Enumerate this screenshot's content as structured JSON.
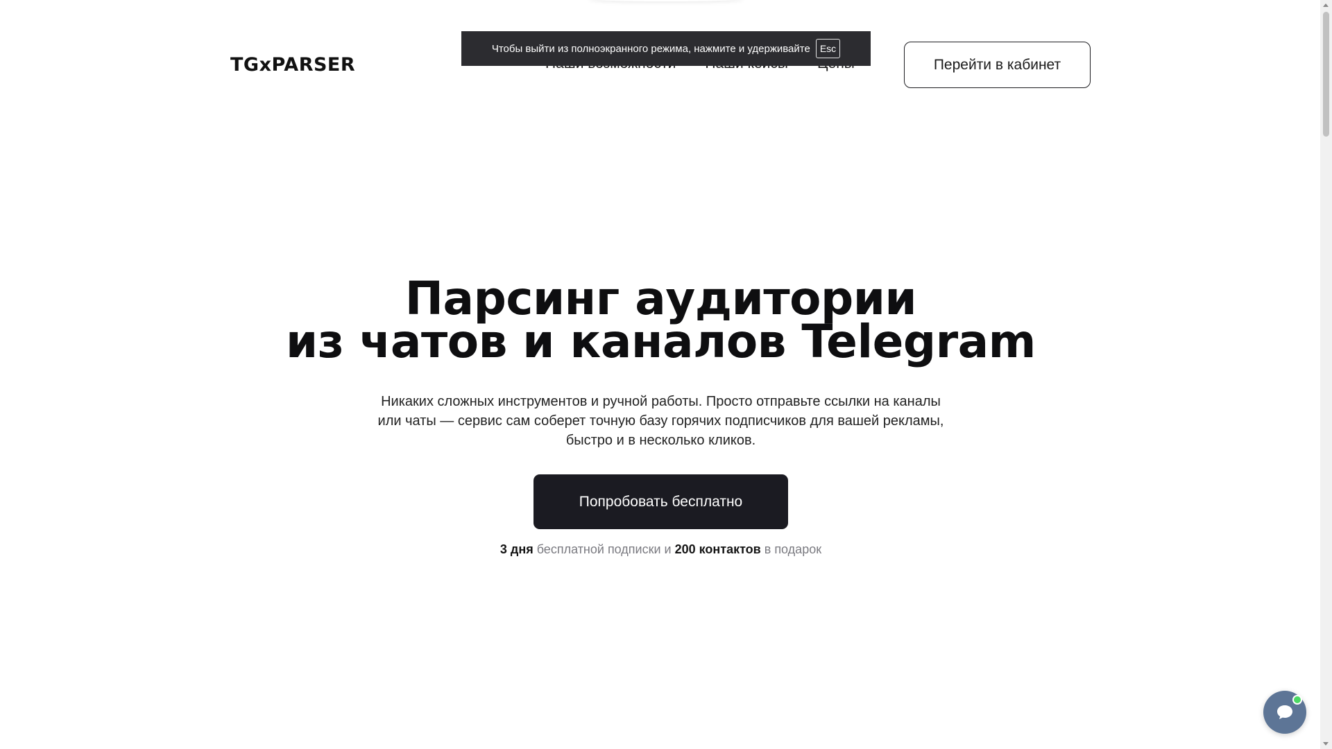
{
  "header": {
    "logo": "TGxPARSER",
    "nav": [
      "Наши возможности",
      "Наши кейсы",
      "Цены"
    ],
    "cabinet_button": "Перейти в кабинет"
  },
  "fullscreen_notice": {
    "text": "Чтобы выйти из полноэкранного режима, нажмите и удерживайте",
    "key": "Esc"
  },
  "hero": {
    "title_line1": "Парсинг аудитории",
    "title_line2": "из чатов и каналов Telegram",
    "subtitle": "Никаких сложных инструментов и ручной работы. Просто отправьте ссылки на каналы или чаты — сервис сам соберет точную базу горячих подписчиков для вашей рекламы, быстро и в несколько кликов.",
    "cta_button": "Попробовать бесплатно",
    "gift_note": {
      "part1_bold": "3 дня",
      "part2": " бесплатной подписки и ",
      "part3_bold": "200 контактов",
      "part4": " в подарок"
    }
  },
  "chat_widget": {
    "icon": "chat-bubble-icon",
    "status": "online"
  },
  "colors": {
    "primary_dark": "#1b1b22",
    "notice_bg": "#2c2c30",
    "chat_widget": "#5d7596",
    "online": "#4cd964",
    "muted_text": "#7a7a80"
  }
}
